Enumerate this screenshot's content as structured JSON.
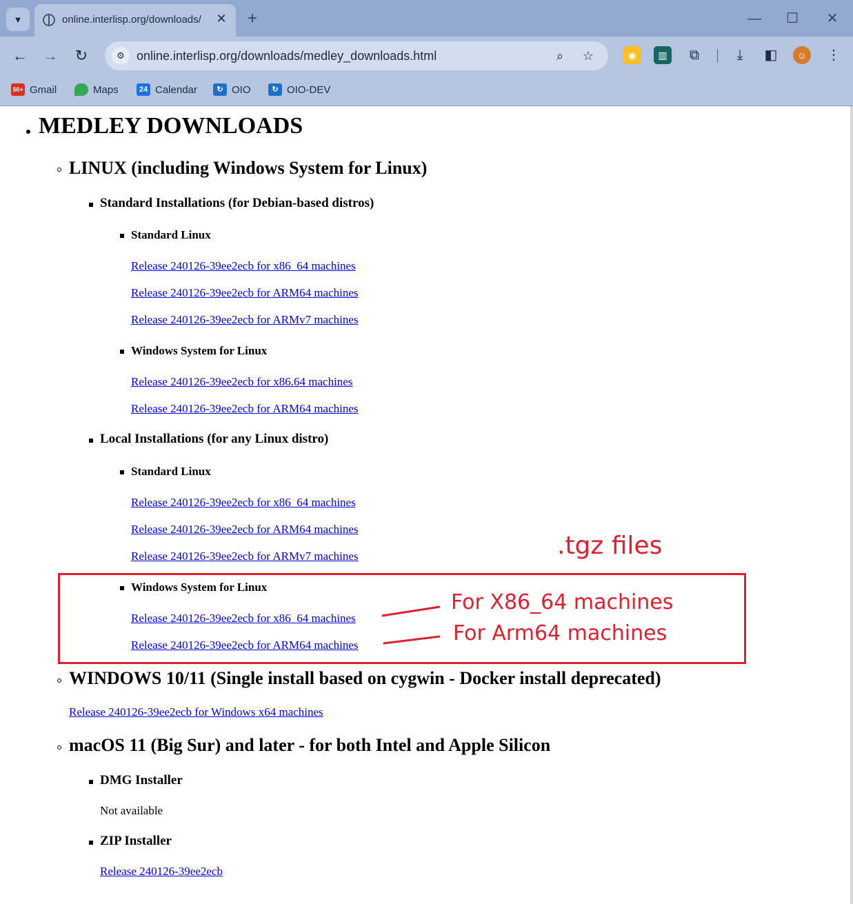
{
  "browser": {
    "tab_title": "online.interlisp.org/downloads/",
    "url": "online.interlisp.org/downloads/medley_downloads.html",
    "bookmarks": [
      {
        "label": "Gmail"
      },
      {
        "label": "Maps"
      },
      {
        "label": "Calendar"
      },
      {
        "label": "OIO"
      },
      {
        "label": "OIO-DEV"
      }
    ],
    "badges": {
      "gmail": "50+",
      "calendar": "24"
    },
    "icons": {
      "tab_search": "chevron-down-icon",
      "favicon": "globe-icon",
      "tab_close": "close-icon",
      "new_tab": "plus-icon",
      "minimize": "minimize-icon",
      "maximize": "maximize-icon",
      "close_window": "close-icon",
      "back": "back-arrow-icon",
      "forward": "forward-arrow-icon",
      "reload": "reload-icon",
      "site_info": "tune-icon",
      "zoom": "zoom-icon",
      "bookmark": "star-icon",
      "extensions": "puzzle-icon",
      "downloads": "download-icon",
      "side_panel": "side-panel-icon",
      "menu": "kebab-menu-icon"
    }
  },
  "page": {
    "title": "MEDLEY DOWNLOADS",
    "linux": {
      "heading": "LINUX (including Windows System for Linux)",
      "standard": {
        "heading": "Standard Installations (for Debian-based distros)",
        "std_linux": {
          "heading": "Standard Linux",
          "links": [
            "Release 240126-39ee2ecb for x86_64 machines",
            "Release 240126-39ee2ecb for ARM64 machines",
            "Release 240126-39ee2ecb for ARMv7 machines"
          ]
        },
        "wsl": {
          "heading": "Windows System for Linux",
          "links": [
            "Release 240126-39ee2ecb for x86.64 machines",
            "Release 240126-39ee2ecb for ARM64 machines"
          ]
        }
      },
      "local": {
        "heading": "Local Installations (for any Linux distro)",
        "std_linux": {
          "heading": "Standard Linux",
          "links": [
            "Release 240126-39ee2ecb for x86_64 machines",
            "Release 240126-39ee2ecb for ARM64 machines",
            "Release 240126-39ee2ecb for ARMv7 machines"
          ]
        },
        "wsl": {
          "heading": "Windows System for Linux",
          "links": [
            "Release 240126-39ee2ecb for x86_64 machines",
            "Release 240126-39ee2ecb for ARM64 machines"
          ]
        }
      }
    },
    "windows": {
      "heading": "WINDOWS 10/11 (Single install based on cygwin - Docker install deprecated)",
      "link": "Release 240126-39ee2ecb for Windows x64 machines"
    },
    "macos": {
      "heading": "macOS 11 (Big Sur) and later - for both Intel and Apple Silicon",
      "dmg": {
        "heading": "DMG Installer",
        "text": "Not available"
      },
      "zip": {
        "heading": "ZIP Installer",
        "link": "Release 240126-39ee2ecb"
      }
    }
  },
  "annotations": {
    "tgz": ".tgz files",
    "x86": "For X86_64 machines",
    "arm": "For Arm64 machines",
    "color": "#e21f2c"
  }
}
